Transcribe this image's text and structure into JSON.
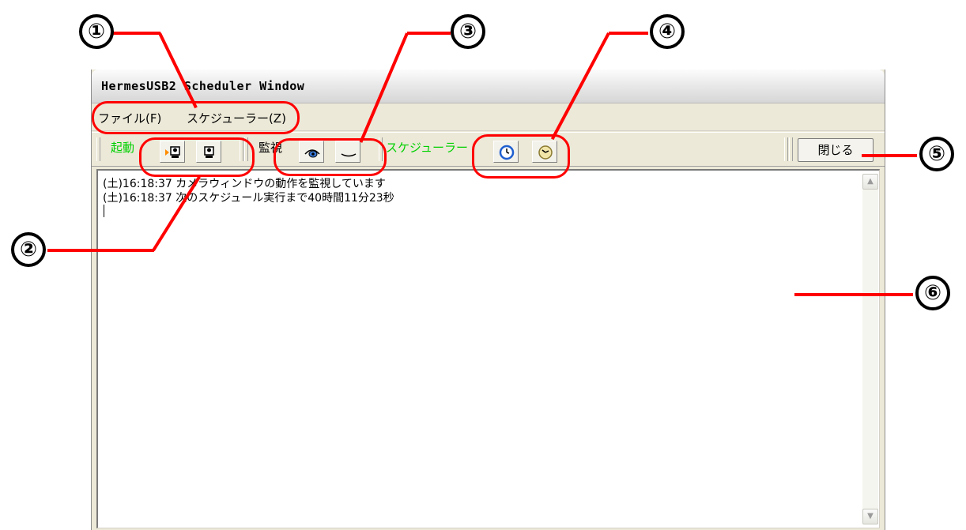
{
  "window": {
    "title": "HermesUSB2 Scheduler Window"
  },
  "menu": {
    "items": [
      {
        "label": "ファイル(F)"
      },
      {
        "label": "スケジューラー(Z)"
      }
    ]
  },
  "toolbar": {
    "launch_label": "起動",
    "launch_buttons": [
      {
        "icon": "camera-start-icon"
      },
      {
        "icon": "camera-stop-icon"
      }
    ],
    "monitor_label": "監視",
    "monitor_buttons": [
      {
        "icon": "eye-open-icon"
      },
      {
        "icon": "eye-closed-icon"
      }
    ],
    "scheduler_label": "スケジューラー",
    "scheduler_buttons": [
      {
        "icon": "clock-start-icon"
      },
      {
        "icon": "clock-stop-icon"
      }
    ],
    "close_label": "閉じる",
    "label_colors": {
      "launch": "#00d000",
      "monitor": "#000000",
      "scheduler": "#00d000"
    }
  },
  "log": {
    "lines": [
      "(土)16:18:37 カメラウィンドウの動作を監視しています",
      "(土)16:18:37 次のスケジュール実行まで40時間11分23秒"
    ]
  },
  "callouts": [
    "①",
    "②",
    "③",
    "④",
    "⑤",
    "⑥"
  ],
  "annotation_color": "#ff0000"
}
